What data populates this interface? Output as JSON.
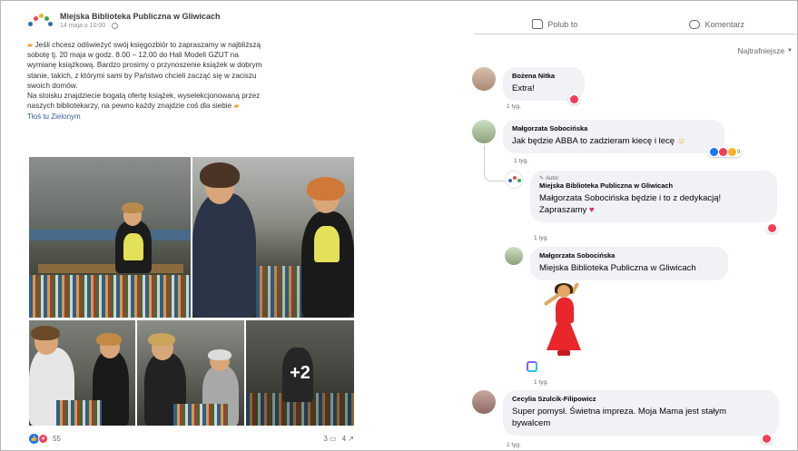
{
  "post": {
    "page_name": "Miejska Biblioteka Publiczna w Gliwicach",
    "timestamp": "14 maja o 10:00 ·",
    "text_lines": [
      "Jeśli chcesz odświeżyć swój księgozbiór to zapraszamy w najbliższą",
      "sobotę tj. 20 maja w godz. 8.00 – 12.00 do   Hali Modeli GZUT   na",
      "wymianę książkową. Bardzo prosimy o przynoszenie książek w dobrym",
      "stanie, takich, z którymi sami by Państwo chcieli zacząć się w zaciszu",
      "swoich domów.",
      "Na stoisku znajdziecie bogatą ofertę książek, wyselekcjonowaną przez",
      "naszych bibliotekarzy, na pewno każdy znajdzie coś dla siebie"
    ],
    "see_translation": "Tłoś tu Zielonym",
    "more_photos": "+2",
    "reaction_count": "55",
    "comments_count": "3",
    "shares_count": "4"
  },
  "actions": {
    "like_label": "Polub to",
    "comment_label": "Komentarz",
    "sort_label": "Najtrafniejsze"
  },
  "comments": [
    {
      "author": "Bożena Nitka",
      "text": "Extra!",
      "time": "1 tyg."
    },
    {
      "author": "Małgorzata Sobocińska",
      "text": "Jak będzie ABBA to zadzieram kiecę i lecę",
      "time": "1 tyg.",
      "react_count": "9"
    },
    {
      "author_tag": "Autor",
      "author": "Miejska Biblioteka Publiczna w Gliwicach",
      "text_line1": "Małgorzata Sobocińska będzie i to z dedykacją!",
      "text_line2": "Zapraszamy",
      "time": "1 tyg."
    },
    {
      "author": "Małgorzata Sobocińska",
      "text": "Miejska Biblioteka Publiczna w Gliwicach",
      "time": "1 tyg."
    },
    {
      "author": "Cecylia Szulcik-Filipowicz",
      "text_line1": "Super pomysł. Świetna impreza. Moja Mama jest stałym",
      "text_line2": "bywalcem",
      "time": "1 tyg."
    }
  ],
  "colors": {
    "like_blue": "#1877f2",
    "love_red": "#f33e58",
    "link_blue": "#385898",
    "bubble_gray": "#f0f2f5"
  }
}
